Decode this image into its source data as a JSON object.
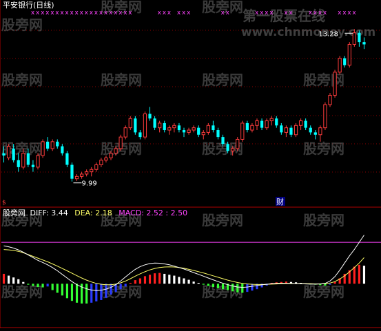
{
  "title": "平安银行(日线)",
  "colors": {
    "background": "#000000",
    "up": "#ff3c3c",
    "down": "#00ffff",
    "grid": "#8b0000",
    "divider": "#b00000",
    "sell_mark": "#ff44ff",
    "diff_line": "#ffffff",
    "dea_line": "#ffff66",
    "macd_text": "#ff44ff",
    "hist_up_red": "#ff2020",
    "hist_up_white": "#ffffff",
    "hist_down_green": "#33ff33",
    "hist_down_blue": "#2a3cff",
    "watermark": "#6a6a6a"
  },
  "annotations": {
    "low_label": "9.99",
    "high_label": "13.28",
    "cai_marker": "财",
    "s_marker": "$",
    "sell_mark_glyph": "x"
  },
  "indicator": {
    "name": "股旁网",
    "diff_label": "DIFF:",
    "diff_value": "3.44",
    "dea_label": "DEA:",
    "dea_value": "2.18",
    "macd_label": "MACD:",
    "macd_value": "2.52",
    "macd_extra": ": 2.50"
  },
  "watermarks": [
    "股旁网",
    "第一股票在线",
    "www.chnmoney.com"
  ],
  "chart_data": [
    {
      "type": "candlestick",
      "title": "平安银行(日线)",
      "ylim": [
        9.6,
        13.7
      ],
      "candles": [
        [
          10.6,
          10.75,
          10.4,
          10.55
        ],
        [
          10.5,
          10.8,
          10.45,
          10.75
        ],
        [
          10.7,
          10.8,
          10.4,
          10.45
        ],
        [
          10.45,
          10.6,
          10.2,
          10.3
        ],
        [
          10.3,
          10.7,
          10.25,
          10.6
        ],
        [
          10.6,
          10.7,
          10.3,
          10.35
        ],
        [
          10.35,
          10.45,
          10.2,
          10.3
        ],
        [
          10.3,
          10.6,
          10.25,
          10.55
        ],
        [
          10.55,
          10.9,
          10.5,
          10.85
        ],
        [
          10.85,
          10.95,
          10.65,
          10.7
        ],
        [
          10.7,
          10.9,
          10.65,
          10.85
        ],
        [
          10.85,
          10.9,
          10.7,
          10.75
        ],
        [
          10.75,
          10.8,
          10.55,
          10.6
        ],
        [
          10.6,
          10.65,
          10.3,
          10.35
        ],
        [
          10.35,
          10.4,
          9.99,
          10.05
        ],
        [
          10.05,
          10.15,
          10.0,
          10.1
        ],
        [
          10.1,
          10.2,
          10.05,
          10.15
        ],
        [
          10.15,
          10.25,
          10.1,
          10.2
        ],
        [
          10.2,
          10.3,
          10.1,
          10.25
        ],
        [
          10.25,
          10.4,
          10.2,
          10.35
        ],
        [
          10.35,
          10.5,
          10.3,
          10.45
        ],
        [
          10.45,
          10.55,
          10.4,
          10.5
        ],
        [
          10.5,
          10.65,
          10.45,
          10.6
        ],
        [
          10.6,
          10.75,
          10.55,
          10.7
        ],
        [
          10.7,
          11.0,
          10.65,
          10.95
        ],
        [
          10.95,
          11.2,
          10.9,
          11.15
        ],
        [
          11.15,
          11.4,
          11.1,
          11.35
        ],
        [
          11.35,
          11.4,
          11.0,
          11.05
        ],
        [
          11.05,
          11.1,
          10.9,
          10.95
        ],
        [
          10.95,
          11.5,
          10.9,
          11.45
        ],
        [
          11.45,
          11.6,
          11.3,
          11.35
        ],
        [
          11.35,
          11.4,
          11.1,
          11.15
        ],
        [
          11.15,
          11.3,
          11.05,
          11.25
        ],
        [
          11.25,
          11.3,
          11.05,
          11.1
        ],
        [
          11.1,
          11.2,
          11.0,
          11.15
        ],
        [
          11.15,
          11.25,
          11.05,
          11.2
        ],
        [
          11.2,
          11.25,
          11.05,
          11.1
        ],
        [
          11.1,
          11.15,
          10.95,
          11.05
        ],
        [
          11.05,
          11.15,
          11.0,
          11.1
        ],
        [
          11.1,
          11.2,
          11.05,
          11.15
        ],
        [
          11.15,
          11.2,
          10.95,
          11.0
        ],
        [
          11.0,
          11.1,
          10.9,
          11.05
        ],
        [
          11.05,
          11.25,
          11.0,
          11.2
        ],
        [
          11.2,
          11.3,
          11.05,
          11.1
        ],
        [
          11.1,
          11.15,
          10.9,
          10.95
        ],
        [
          10.95,
          11.0,
          10.75,
          10.8
        ],
        [
          10.8,
          10.85,
          10.6,
          10.65
        ],
        [
          10.65,
          10.75,
          10.55,
          10.7
        ],
        [
          10.7,
          10.95,
          10.65,
          10.9
        ],
        [
          10.9,
          11.3,
          10.85,
          11.25
        ],
        [
          11.25,
          11.3,
          11.05,
          11.1
        ],
        [
          11.1,
          11.25,
          11.05,
          11.2
        ],
        [
          11.2,
          11.35,
          11.1,
          11.3
        ],
        [
          11.3,
          11.35,
          11.1,
          11.15
        ],
        [
          11.15,
          11.35,
          11.1,
          11.3
        ],
        [
          11.3,
          11.4,
          11.2,
          11.35
        ],
        [
          11.35,
          11.4,
          11.15,
          11.2
        ],
        [
          11.2,
          11.25,
          11.0,
          11.05
        ],
        [
          11.05,
          11.2,
          10.95,
          11.15
        ],
        [
          11.15,
          11.2,
          10.95,
          11.0
        ],
        [
          11.0,
          11.25,
          10.95,
          11.2
        ],
        [
          11.2,
          11.35,
          11.1,
          11.3
        ],
        [
          11.3,
          11.35,
          11.1,
          11.15
        ],
        [
          11.15,
          11.2,
          11.0,
          11.05
        ],
        [
          11.05,
          11.1,
          10.9,
          11.0
        ],
        [
          11.0,
          11.2,
          10.85,
          11.15
        ],
        [
          11.15,
          11.7,
          11.1,
          11.65
        ],
        [
          11.65,
          11.9,
          11.6,
          11.85
        ],
        [
          11.85,
          12.4,
          11.8,
          12.35
        ],
        [
          12.35,
          12.7,
          12.3,
          12.65
        ],
        [
          12.65,
          12.7,
          12.45,
          12.5
        ],
        [
          12.5,
          13.0,
          12.45,
          12.95
        ],
        [
          12.95,
          13.28,
          12.9,
          13.2
        ],
        [
          13.2,
          13.25,
          12.9,
          13.0
        ],
        [
          13.0,
          13.1,
          12.85,
          12.95
        ]
      ]
    },
    {
      "type": "macd",
      "series_names": [
        "DIFF",
        "DEA",
        "MACD"
      ],
      "latest": {
        "DIFF": 3.44,
        "DEA": 2.18,
        "MACD": 2.52
      },
      "hist": [
        0.55,
        0.45,
        0.35,
        0.25,
        0.1,
        -0.05,
        -0.12,
        -0.18,
        -0.2,
        -0.15,
        -0.35,
        -0.5,
        -0.65,
        -0.8,
        -0.95,
        -1.05,
        -1.1,
        -1.1,
        -1.05,
        -0.98,
        -0.9,
        -0.78,
        -0.6,
        -0.45,
        -0.3,
        -0.15,
        0.05,
        0.2,
        0.3,
        0.42,
        0.5,
        0.58,
        0.6,
        0.55,
        0.5,
        0.45,
        0.38,
        0.3,
        0.22,
        0.12,
        0.05,
        -0.05,
        -0.12,
        -0.18,
        -0.25,
        -0.3,
        -0.35,
        -0.42,
        -0.48,
        -0.5,
        -0.45,
        -0.38,
        -0.3,
        -0.2,
        -0.1,
        0.05,
        0.08,
        0.1,
        0.12,
        0.1,
        0.08,
        0.05,
        0.02,
        -0.02,
        -0.05,
        -0.08,
        -0.1,
        -0.05,
        0.1,
        0.3,
        0.55,
        0.75,
        0.95,
        1.05,
        1.0
      ],
      "diff": [
        2.1,
        2.05,
        1.98,
        1.88,
        1.75,
        1.6,
        1.45,
        1.3,
        1.18,
        1.05,
        0.9,
        0.72,
        0.52,
        0.32,
        0.12,
        -0.05,
        -0.18,
        -0.28,
        -0.35,
        -0.38,
        -0.36,
        -0.3,
        -0.2,
        -0.05,
        0.15,
        0.38,
        0.6,
        0.8,
        0.95,
        1.05,
        1.12,
        1.15,
        1.14,
        1.1,
        1.05,
        0.98,
        0.9,
        0.82,
        0.72,
        0.62,
        0.52,
        0.42,
        0.32,
        0.22,
        0.12,
        0.03,
        -0.05,
        -0.12,
        -0.18,
        -0.2,
        -0.18,
        -0.14,
        -0.1,
        -0.06,
        -0.03,
        0.0,
        0.02,
        0.03,
        0.03,
        0.02,
        0.01,
        0.0,
        -0.01,
        -0.02,
        -0.02,
        -0.01,
        0.02,
        0.15,
        0.4,
        0.75,
        1.15,
        1.55,
        1.9,
        2.3,
        2.7
      ],
      "dea": [
        1.9,
        1.88,
        1.85,
        1.8,
        1.72,
        1.62,
        1.52,
        1.42,
        1.32,
        1.22,
        1.1,
        0.98,
        0.85,
        0.72,
        0.58,
        0.45,
        0.32,
        0.2,
        0.1,
        0.02,
        -0.03,
        -0.05,
        -0.05,
        -0.02,
        0.05,
        0.15,
        0.28,
        0.42,
        0.55,
        0.67,
        0.77,
        0.85,
        0.9,
        0.93,
        0.94,
        0.93,
        0.9,
        0.86,
        0.8,
        0.74,
        0.67,
        0.6,
        0.52,
        0.44,
        0.36,
        0.28,
        0.2,
        0.13,
        0.07,
        0.02,
        -0.01,
        -0.03,
        -0.04,
        -0.04,
        -0.03,
        -0.02,
        -0.01,
        0.0,
        0.01,
        0.01,
        0.01,
        0.01,
        0.0,
        0.0,
        -0.01,
        -0.01,
        0.0,
        0.04,
        0.12,
        0.26,
        0.44,
        0.66,
        0.9,
        1.15,
        1.45
      ],
      "reference_level": 2.3,
      "ylim": [
        -2.2,
        3.6
      ]
    }
  ]
}
